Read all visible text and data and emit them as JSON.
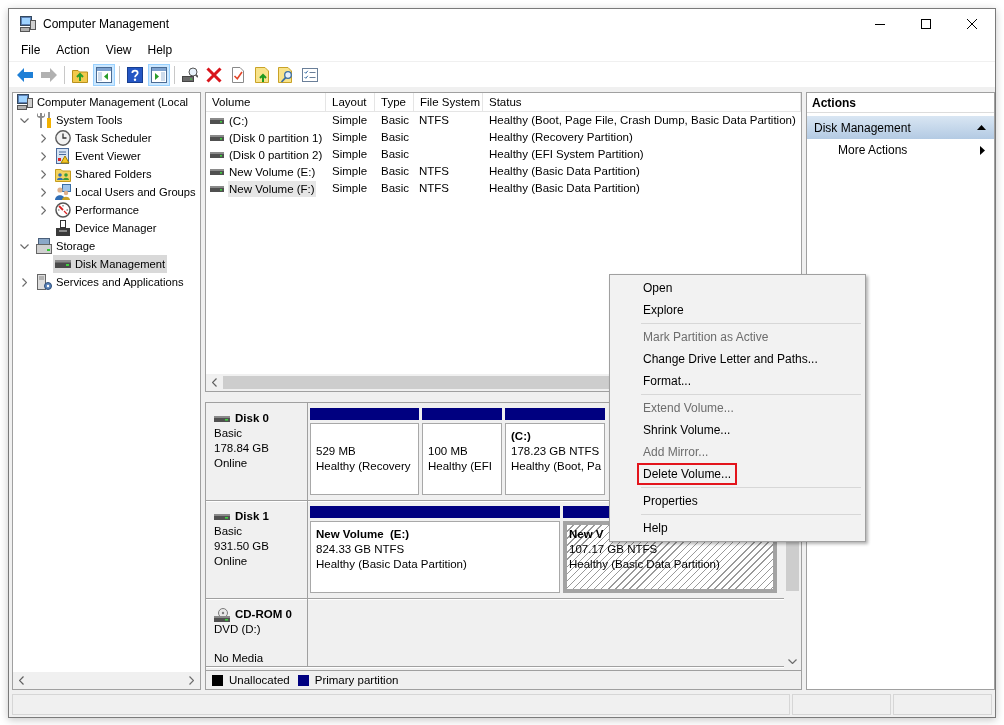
{
  "window": {
    "title": "Computer Management"
  },
  "menu_bar": [
    "File",
    "Action",
    "View",
    "Help"
  ],
  "toolbar": [
    {
      "pressed": false,
      "disabled": false
    },
    {
      "pressed": false,
      "disabled": true
    },
    {
      "pressed": false,
      "disabled": false
    },
    {
      "pressed": true,
      "disabled": false
    },
    {
      "pressed": false,
      "disabled": false
    },
    {
      "pressed": true,
      "disabled": false
    },
    {
      "pressed": false,
      "disabled": false
    },
    {
      "pressed": false,
      "disabled": false
    },
    {
      "pressed": false,
      "disabled": false
    },
    {
      "pressed": false,
      "disabled": false
    },
    {
      "pressed": false,
      "disabled": false
    },
    {
      "pressed": false,
      "disabled": false
    }
  ],
  "tree": {
    "items": [
      {
        "label": "Computer Management (Local",
        "selected": false,
        "children": [
          {
            "label": "System Tools",
            "expanded": true,
            "selected": false,
            "children": [
              {
                "label": "Task Scheduler",
                "expanded": false,
                "selected": false
              },
              {
                "label": "Event Viewer",
                "expanded": false,
                "selected": false
              },
              {
                "label": "Shared Folders",
                "expanded": false,
                "selected": false
              },
              {
                "label": "Local Users and Groups",
                "expanded": false,
                "selected": false
              },
              {
                "label": "Performance",
                "expanded": false,
                "selected": false
              },
              {
                "label": "Device Manager",
                "selected": false
              }
            ]
          },
          {
            "label": "Storage",
            "expanded": true,
            "selected": false,
            "children": [
              {
                "label": "Disk Management",
                "selected": true
              }
            ]
          },
          {
            "label": "Services and Applications",
            "expanded": false,
            "selected": false
          }
        ]
      }
    ]
  },
  "table": {
    "columns": [
      "Volume",
      "Layout",
      "Type",
      "File System",
      "Status"
    ],
    "rows": [
      {
        "volume": "(C:)",
        "layout": "Simple",
        "type": "Basic",
        "file_system": "NTFS",
        "status": "Healthy (Boot, Page File, Crash Dump, Basic Data Partition)",
        "selected": false
      },
      {
        "volume": "(Disk 0 partition 1)",
        "layout": "Simple",
        "type": "Basic",
        "status": "Healthy (Recovery Partition)",
        "selected": false
      },
      {
        "volume": "(Disk 0 partition 2)",
        "layout": "Simple",
        "type": "Basic",
        "status": "Healthy (EFI System Partition)",
        "selected": false
      },
      {
        "volume": "New Volume (E:)",
        "layout": "Simple",
        "type": "Basic",
        "file_system": "NTFS",
        "status": "Healthy (Basic Data Partition)",
        "selected": false
      },
      {
        "volume": "New Volume (F:)",
        "layout": "Simple",
        "type": "Basic",
        "file_system": "NTFS",
        "status": "Healthy (Basic Data Partition)",
        "selected": true
      }
    ]
  },
  "disks": [
    {
      "kind": "disk",
      "name": "Disk 0",
      "type": "Basic",
      "size": "178.84 GB",
      "status": "Online",
      "partitions": [
        {
          "size": "529 MB",
          "status": "Healthy (Recovery",
          "selected": false
        },
        {
          "size": "100 MB",
          "status": "Healthy (EFI",
          "selected": false
        },
        {
          "name": "(C:)",
          "size": "178.23 GB NTFS",
          "status": "Healthy (Boot, Pa",
          "selected": false
        }
      ]
    },
    {
      "kind": "disk",
      "name": "Disk 1",
      "type": "Basic",
      "size": "931.50 GB",
      "status": "Online",
      "partitions": [
        {
          "name": "New Volume  (E:)",
          "size": "824.33 GB NTFS",
          "status": "Healthy (Basic Data Partition)",
          "selected": false
        },
        {
          "name": "New V",
          "size": "107.17 GB NTFS",
          "status": "Healthy (Basic Data Partition)",
          "selected": true
        }
      ]
    },
    {
      "kind": "cdrom",
      "name": "CD-ROM 0",
      "type": "DVD (D:)",
      "status": "No Media"
    }
  ],
  "legend": [
    {
      "label": "Unallocated",
      "color": "#000000"
    },
    {
      "label": "Primary partition",
      "color": "#000080"
    }
  ],
  "actions": {
    "title": "Actions",
    "sections": [
      {
        "title": "Disk Management",
        "expanded": true,
        "items": [
          {
            "label": "More Actions",
            "submenu": true
          }
        ]
      }
    ]
  },
  "context_menu": {
    "items": [
      {
        "kind": "item",
        "label": "Open",
        "disabled": false,
        "highlighted": false
      },
      {
        "kind": "item",
        "label": "Explore",
        "disabled": false,
        "highlighted": false
      },
      {
        "kind": "separator"
      },
      {
        "kind": "item",
        "label": "Mark Partition as Active",
        "disabled": true,
        "highlighted": false
      },
      {
        "kind": "item",
        "label": "Change Drive Letter and Paths...",
        "disabled": false,
        "highlighted": false
      },
      {
        "kind": "item",
        "label": "Format...",
        "disabled": false,
        "highlighted": false
      },
      {
        "kind": "separator"
      },
      {
        "kind": "item",
        "label": "Extend Volume...",
        "disabled": true,
        "highlighted": false
      },
      {
        "kind": "item",
        "label": "Shrink Volume...",
        "disabled": false,
        "highlighted": false
      },
      {
        "kind": "item",
        "label": "Add Mirror...",
        "disabled": true,
        "highlighted": false
      },
      {
        "kind": "item",
        "label": "Delete Volume...",
        "disabled": false,
        "highlighted": true
      },
      {
        "kind": "separator"
      },
      {
        "kind": "item",
        "label": "Properties",
        "disabled": false,
        "highlighted": false
      },
      {
        "kind": "separator"
      },
      {
        "kind": "item",
        "label": "Help",
        "disabled": false,
        "highlighted": false
      }
    ]
  }
}
